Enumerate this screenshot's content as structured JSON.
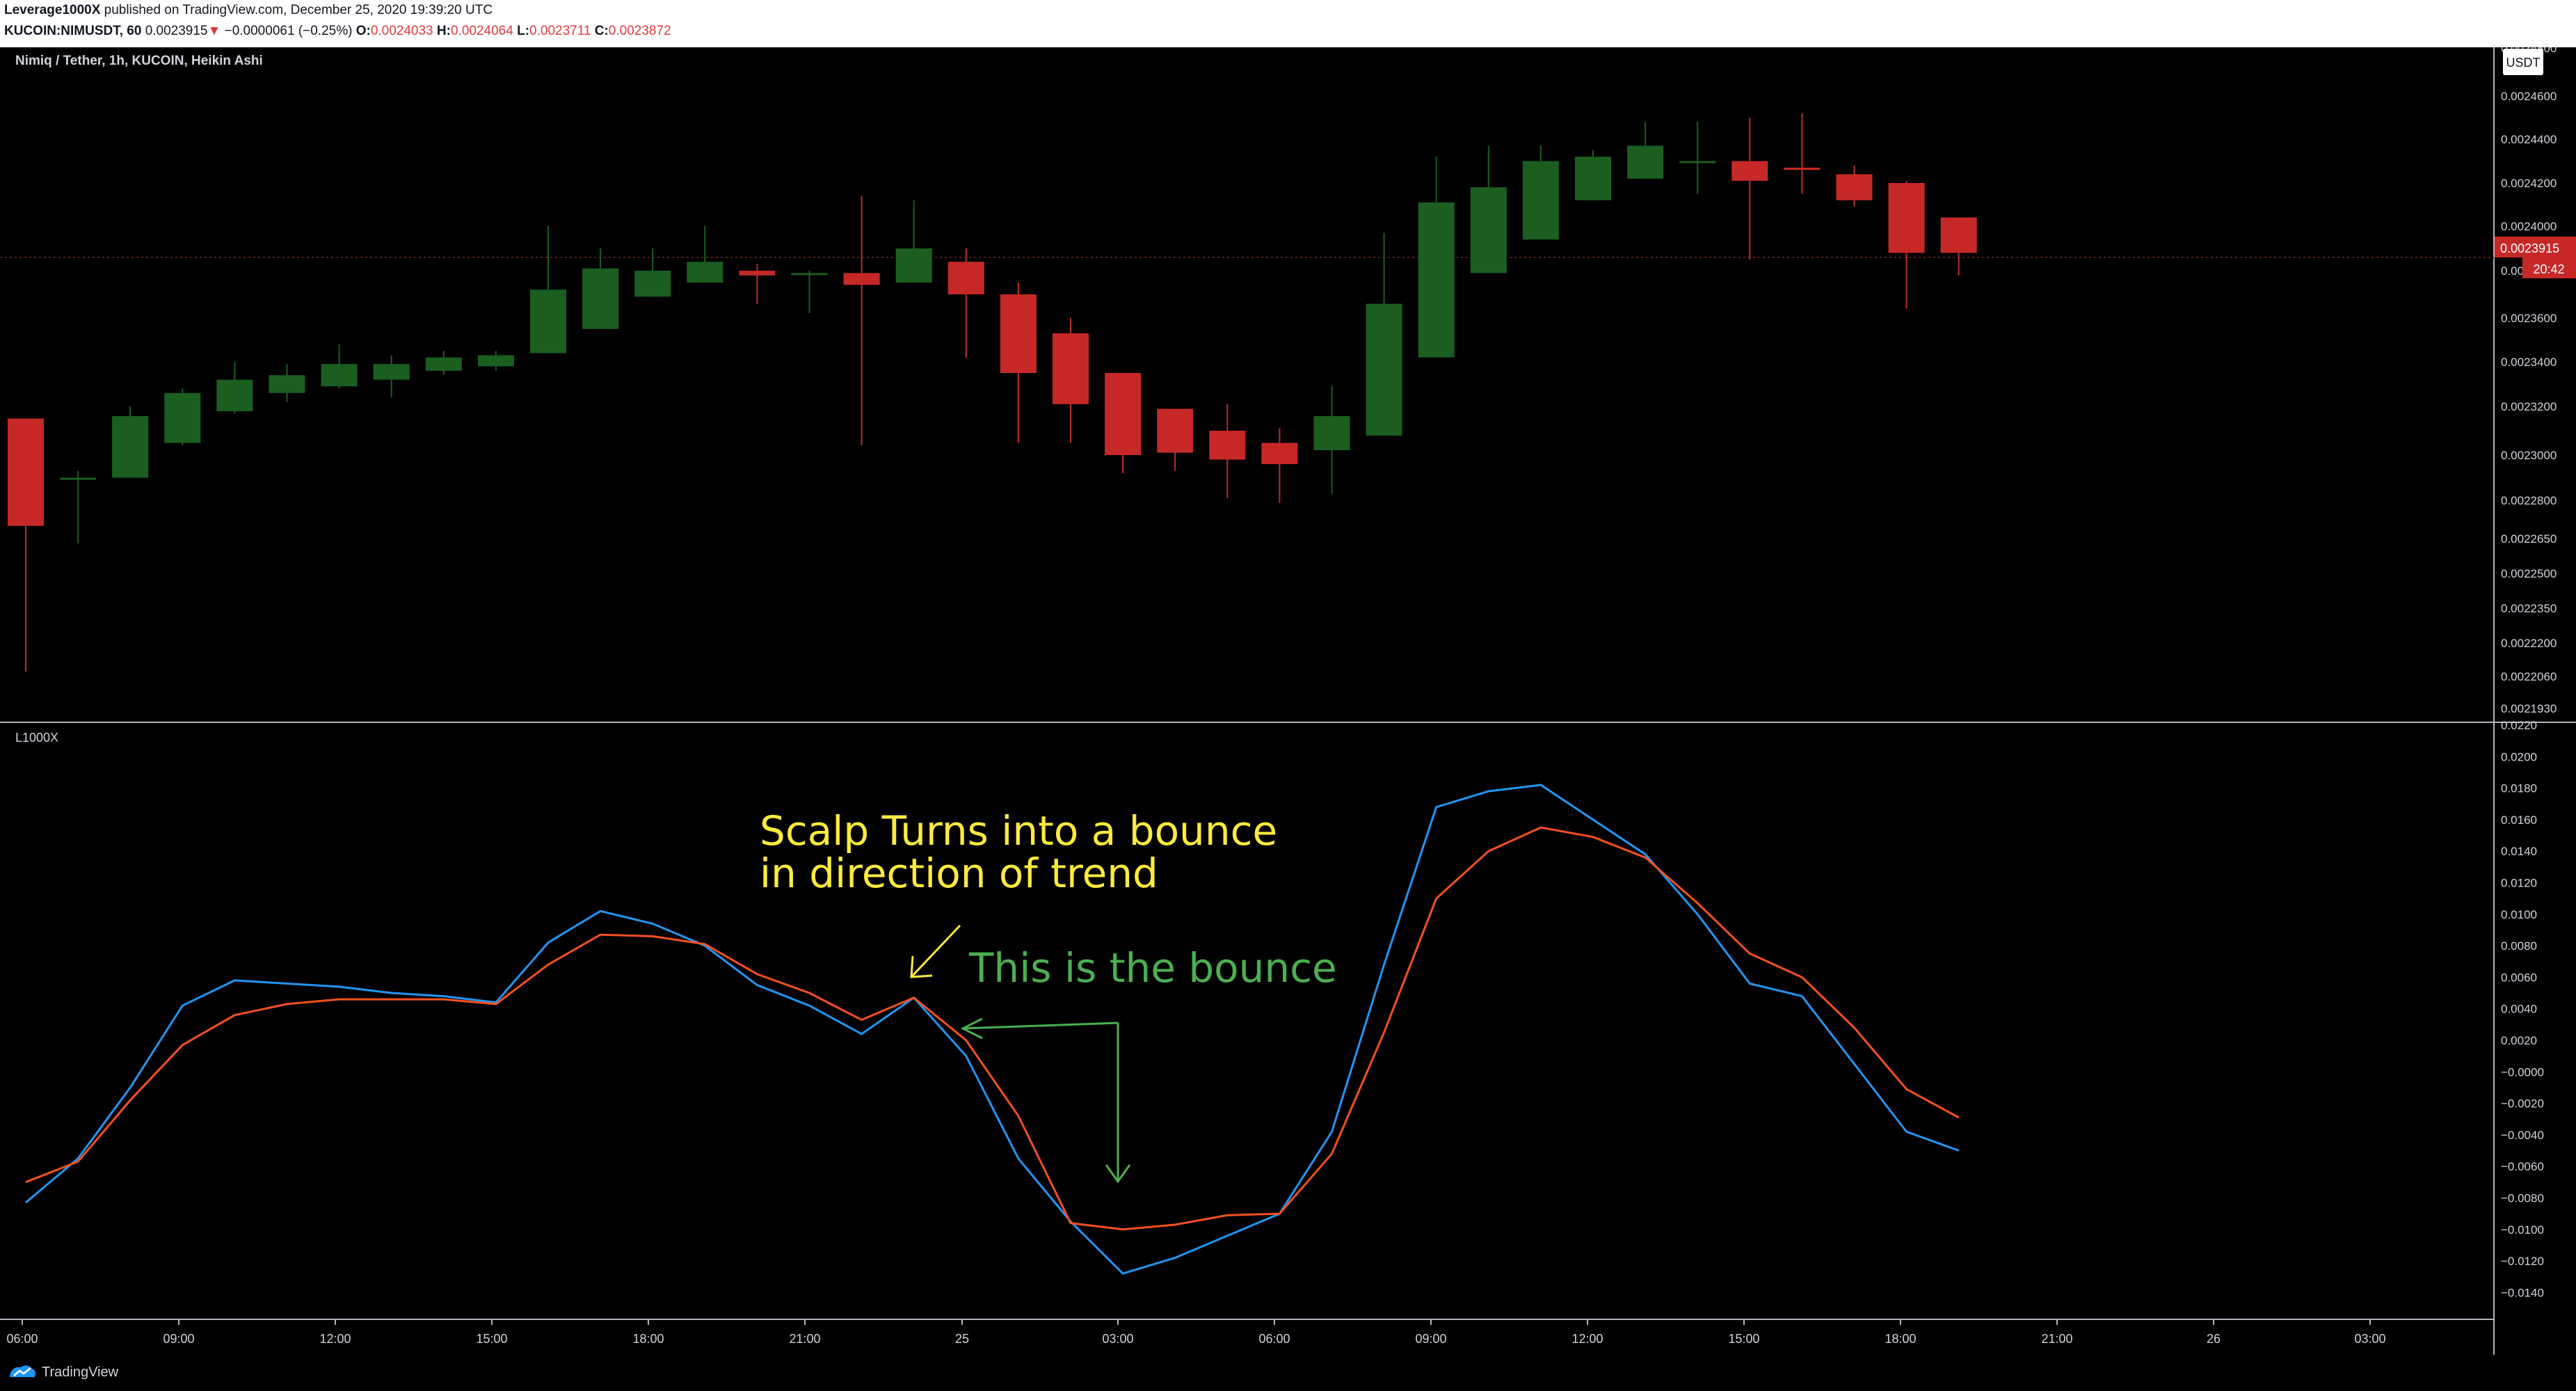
{
  "header": {
    "publisher": "Leverage1000X",
    "published_text": "published on TradingView.com, December 25, 2020 19:39:20 UTC",
    "symbol": "KUCOIN:NIMUSDT, 60",
    "last": "0.0023915",
    "change": "−0.0000061 (−0.25%)",
    "open_label": "O:",
    "open": "0.0024033",
    "high_label": "H:",
    "high": "0.0024064",
    "low_label": "L:",
    "low": "0.0023711",
    "close_label": "C:",
    "close": "0.0023872"
  },
  "main_pane": {
    "legend": "Nimiq / Tether, 1h, KUCOIN, Heikin Ashi",
    "currency": "USDT",
    "price_tag": "0.0023915",
    "countdown_tag": "20:42"
  },
  "indicator_pane": {
    "legend": "L1000X"
  },
  "annotations": {
    "yellow_line1": "Scalp Turns into a bounce",
    "yellow_line2": "in direction of trend",
    "green_text": "This is the bounce"
  },
  "footer": {
    "brand": "TradingView"
  },
  "colors": {
    "up": "#1b5e20",
    "down": "#c62828",
    "blue_line": "#2196f3",
    "orange_line": "#f4511e",
    "yellow": "#ffeb3b",
    "green_note": "#4caf50"
  },
  "chart_data": [
    {
      "type": "candlestick",
      "title": "Nimiq / Tether, 1h, KUCOIN, Heikin Ashi",
      "x": [
        "06:00",
        "09:00",
        "12:00",
        "15:00",
        "18:00",
        "21:00",
        "25",
        "03:00",
        "06:00",
        "09:00",
        "12:00",
        "15:00",
        "18:00",
        "21:00",
        "26",
        "03:00"
      ],
      "price_ticks": [
        "0.0024800",
        "0.0024600",
        "0.0024400",
        "0.0024200",
        "0.0024000",
        "0.0023800",
        "0.0023600",
        "0.0023400",
        "0.0023200",
        "0.0023000",
        "0.0022800",
        "0.0022650",
        "0.0022500",
        "0.0022350",
        "0.0022200",
        "0.0022060",
        "0.0021930"
      ],
      "ohlc": [
        [
          0.002315,
          0.002315,
          0.002208,
          0.00227
        ],
        [
          0.00229,
          0.002293,
          0.002263,
          0.00229
        ],
        [
          0.00229,
          0.00232,
          0.00229,
          0.002316
        ],
        [
          0.002305,
          0.002328,
          0.002304,
          0.002326
        ],
        [
          0.002318,
          0.00234,
          0.002317,
          0.002332
        ],
        [
          0.002326,
          0.002339,
          0.002322,
          0.002334
        ],
        [
          0.002329,
          0.002348,
          0.002328,
          0.002339
        ],
        [
          0.002332,
          0.002343,
          0.002324,
          0.002339
        ],
        [
          0.002336,
          0.002345,
          0.002334,
          0.002342
        ],
        [
          0.002338,
          0.002345,
          0.002336,
          0.002343
        ],
        [
          0.002344,
          0.0024,
          0.002344,
          0.002372
        ],
        [
          0.002355,
          0.00239,
          0.002355,
          0.002381
        ],
        [
          0.002369,
          0.00239,
          0.002369,
          0.00238
        ],
        [
          0.002375,
          0.0024,
          0.002375,
          0.002384
        ],
        [
          0.00238,
          0.002383,
          0.002366,
          0.002378
        ],
        [
          0.002379,
          0.00238,
          0.002362,
          0.002379
        ],
        [
          0.002379,
          0.002414,
          0.002304,
          0.002374
        ],
        [
          0.002375,
          0.002412,
          0.002375,
          0.00239
        ],
        [
          0.002384,
          0.00239,
          0.002342,
          0.00237
        ],
        [
          0.00237,
          0.002375,
          0.002305,
          0.002335
        ],
        [
          0.002353,
          0.00236,
          0.002305,
          0.002321
        ],
        [
          0.002335,
          0.002335,
          0.002292,
          0.0023
        ],
        [
          0.002319,
          0.002319,
          0.002293,
          0.002301
        ],
        [
          0.00231,
          0.002321,
          0.002281,
          0.002298
        ],
        [
          0.002305,
          0.002311,
          0.002279,
          0.002296
        ],
        [
          0.002302,
          0.002329,
          0.002283,
          0.002316
        ],
        [
          0.002308,
          0.002397,
          0.002308,
          0.002366
        ],
        [
          0.002342,
          0.002432,
          0.002342,
          0.002411
        ],
        [
          0.002379,
          0.002437,
          0.002379,
          0.002418
        ],
        [
          0.002394,
          0.002437,
          0.002394,
          0.00243
        ],
        [
          0.002412,
          0.002435,
          0.002412,
          0.002432
        ],
        [
          0.002422,
          0.002448,
          0.002422,
          0.002437
        ],
        [
          0.00243,
          0.002448,
          0.002415,
          0.00243
        ],
        [
          0.00243,
          0.00245,
          0.002385,
          0.002421
        ],
        [
          0.002427,
          0.002452,
          0.002415,
          0.002426
        ],
        [
          0.002424,
          0.002428,
          0.002409,
          0.002412
        ],
        [
          0.00242,
          0.002421,
          0.002364,
          0.002388
        ],
        [
          0.002404,
          0.002404,
          0.002378,
          0.002388
        ]
      ]
    },
    {
      "type": "line",
      "title": "L1000X",
      "x": [
        "06:00",
        "09:00",
        "12:00",
        "15:00",
        "18:00",
        "21:00",
        "25",
        "03:00",
        "06:00",
        "09:00",
        "12:00",
        "15:00",
        "18:00",
        "21:00",
        "26",
        "03:00"
      ],
      "y_ticks": [
        "0.0220",
        "0.0200",
        "0.0180",
        "0.0160",
        "0.0140",
        "0.0120",
        "0.0100",
        "0.0080",
        "0.0060",
        "0.0040",
        "0.0020",
        "−0.0000",
        "−0.0020",
        "−0.0040",
        "−0.0060",
        "−0.0080",
        "−0.0100",
        "−0.0120",
        "−0.0140"
      ],
      "series": [
        {
          "values": [
            -0.0083,
            -0.0055,
            -0.001,
            0.0042,
            0.0058,
            0.0056,
            0.0054,
            0.005,
            0.0048,
            0.0044,
            0.0082,
            0.0102,
            0.0094,
            0.008,
            0.0055,
            0.0042,
            0.0024,
            0.0047,
            0.001,
            -0.0055,
            -0.0095,
            -0.0128,
            -0.0118,
            -0.0104,
            -0.009,
            -0.0038,
            0.0068,
            0.0168,
            0.0178,
            0.0182,
            0.016,
            0.0138,
            0.01,
            0.0056,
            0.0048,
            0.0005,
            -0.0038,
            -0.005
          ]
        },
        {
          "values": [
            -0.007,
            -0.0057,
            -0.0018,
            0.0017,
            0.0036,
            0.0043,
            0.0046,
            0.0046,
            0.0046,
            0.0043,
            0.0068,
            0.0087,
            0.0086,
            0.0081,
            0.0062,
            0.005,
            0.0033,
            0.0047,
            0.002,
            -0.0028,
            -0.0096,
            -0.01,
            -0.0097,
            -0.0091,
            -0.009,
            -0.0052,
            0.0025,
            0.011,
            0.014,
            0.0155,
            0.0149,
            0.0136,
            0.0107,
            0.0075,
            0.006,
            0.0028,
            -0.0011,
            -0.0029
          ]
        }
      ]
    }
  ]
}
